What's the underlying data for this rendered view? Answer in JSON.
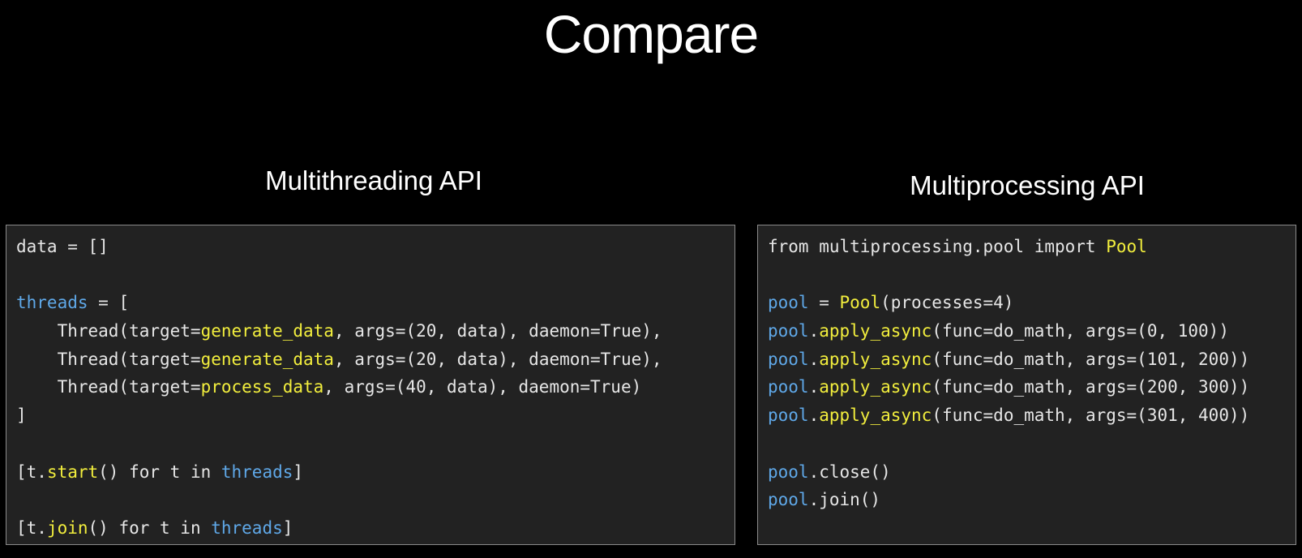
{
  "slide": {
    "title": "Compare"
  },
  "left": {
    "heading": "Multithreading API",
    "lines": [
      [
        {
          "t": "data = []",
          "c": ""
        }
      ],
      [],
      [
        {
          "t": "threads",
          "c": "kw-var"
        },
        {
          "t": " = [",
          "c": ""
        }
      ],
      [
        {
          "t": "    Thread(target=",
          "c": ""
        },
        {
          "t": "generate_data",
          "c": "kw-fn"
        },
        {
          "t": ", args=(20, data), daemon=True),",
          "c": ""
        }
      ],
      [
        {
          "t": "    Thread(target=",
          "c": ""
        },
        {
          "t": "generate_data",
          "c": "kw-fn"
        },
        {
          "t": ", args=(20, data), daemon=True),",
          "c": ""
        }
      ],
      [
        {
          "t": "    Thread(target=",
          "c": ""
        },
        {
          "t": "process_data",
          "c": "kw-fn"
        },
        {
          "t": ", args=(40, data), daemon=True)",
          "c": ""
        }
      ],
      [
        {
          "t": "]",
          "c": ""
        }
      ],
      [],
      [
        {
          "t": "[t.",
          "c": ""
        },
        {
          "t": "start",
          "c": "kw-fn"
        },
        {
          "t": "() for t in ",
          "c": ""
        },
        {
          "t": "threads",
          "c": "kw-var"
        },
        {
          "t": "]",
          "c": ""
        }
      ],
      [],
      [
        {
          "t": "[t.",
          "c": ""
        },
        {
          "t": "join",
          "c": "kw-fn"
        },
        {
          "t": "() for t in ",
          "c": ""
        },
        {
          "t": "threads",
          "c": "kw-var"
        },
        {
          "t": "]",
          "c": ""
        }
      ]
    ]
  },
  "right": {
    "heading": "Multiprocessing API",
    "lines": [
      [
        {
          "t": "from multiprocessing.pool import ",
          "c": ""
        },
        {
          "t": "Pool",
          "c": "kw-fn"
        }
      ],
      [],
      [
        {
          "t": "pool",
          "c": "kw-var"
        },
        {
          "t": " = ",
          "c": ""
        },
        {
          "t": "Pool",
          "c": "kw-fn"
        },
        {
          "t": "(processes=4)",
          "c": ""
        }
      ],
      [
        {
          "t": "pool",
          "c": "kw-var"
        },
        {
          "t": ".",
          "c": ""
        },
        {
          "t": "apply_async",
          "c": "kw-fn"
        },
        {
          "t": "(func=do_math, args=(0, 100))",
          "c": ""
        }
      ],
      [
        {
          "t": "pool",
          "c": "kw-var"
        },
        {
          "t": ".",
          "c": ""
        },
        {
          "t": "apply_async",
          "c": "kw-fn"
        },
        {
          "t": "(func=do_math, args=(101, 200))",
          "c": ""
        }
      ],
      [
        {
          "t": "pool",
          "c": "kw-var"
        },
        {
          "t": ".",
          "c": ""
        },
        {
          "t": "apply_async",
          "c": "kw-fn"
        },
        {
          "t": "(func=do_math, args=(200, 300))",
          "c": ""
        }
      ],
      [
        {
          "t": "pool",
          "c": "kw-var"
        },
        {
          "t": ".",
          "c": ""
        },
        {
          "t": "apply_async",
          "c": "kw-fn"
        },
        {
          "t": "(func=do_math, args=(301, 400))",
          "c": ""
        }
      ],
      [],
      [
        {
          "t": "pool",
          "c": "kw-var"
        },
        {
          "t": ".close()",
          "c": ""
        }
      ],
      [
        {
          "t": "pool",
          "c": "kw-var"
        },
        {
          "t": ".join()",
          "c": ""
        }
      ]
    ]
  },
  "colors": {
    "background": "#000000",
    "panel": "#222222",
    "panel_border": "#8a8a8a",
    "code_text": "#e6e6e6",
    "identifier_blue": "#5fa8e8",
    "function_yellow": "#f2ee3d"
  }
}
